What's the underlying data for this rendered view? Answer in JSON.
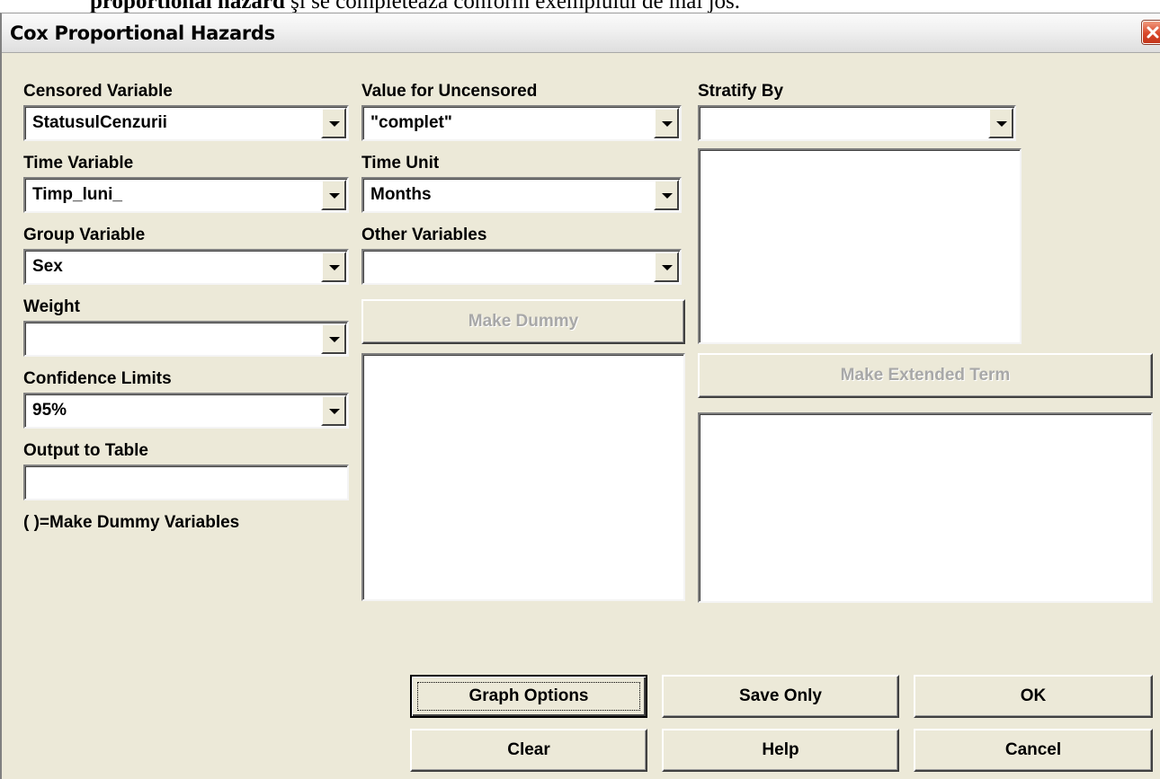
{
  "document_text": {
    "bold": "proportional hazard",
    "rest": " şi se completează conform exemplului de mai jos."
  },
  "window": {
    "title": "Cox Proportional Hazards"
  },
  "fields": {
    "censored_variable": {
      "label": "Censored Variable",
      "value": "StatusulCenzurii"
    },
    "time_variable": {
      "label": "Time Variable",
      "value": "Timp_luni_"
    },
    "group_variable": {
      "label": "Group Variable",
      "value": "Sex"
    },
    "weight": {
      "label": "Weight",
      "value": ""
    },
    "confidence_limits": {
      "label": "Confidence Limits",
      "value": "95%"
    },
    "output_to_table": {
      "label": "Output to Table",
      "value": ""
    },
    "value_for_uncensored": {
      "label": "Value for Uncensored",
      "value": "\"complet\""
    },
    "time_unit": {
      "label": "Time Unit",
      "value": "Months"
    },
    "other_variables": {
      "label": "Other Variables",
      "value": ""
    },
    "stratify_by": {
      "label": "Stratify By",
      "value": ""
    }
  },
  "notes": {
    "dummy_hint": "( )=Make Dummy Variables"
  },
  "buttons": {
    "make_dummy": "Make Dummy",
    "make_extended_term": "Make Extended Term",
    "graph_options": "Graph Options",
    "save_only": "Save Only",
    "ok": "OK",
    "clear": "Clear",
    "help": "Help",
    "cancel": "Cancel"
  },
  "colors": {
    "dialog_bg": "#ece9d8",
    "close_button": "#d9472a",
    "disabled_text": "#a8a8a8"
  }
}
